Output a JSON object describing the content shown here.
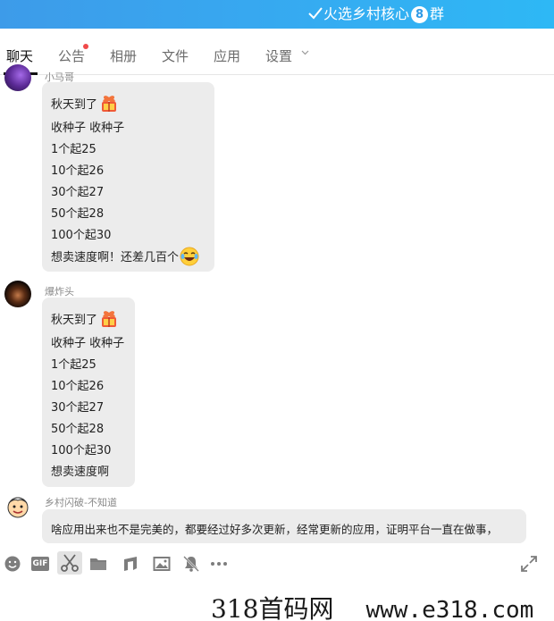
{
  "window": {
    "title_prefix": "火选乡村核心",
    "badge": "8",
    "title_suffix": "群"
  },
  "tabs": [
    {
      "label": "聊天",
      "active": true
    },
    {
      "label": "公告",
      "has_dot": true
    },
    {
      "label": "相册"
    },
    {
      "label": "文件"
    },
    {
      "label": "应用"
    },
    {
      "label": "设置"
    }
  ],
  "messages": [
    {
      "sender": "小马哥",
      "lines": [
        "秋天到了",
        "收种子 收种子",
        "1个起25",
        "10个起26",
        "30个起27",
        "50个起28",
        "100个起30",
        "想卖速度啊！还差几百个"
      ]
    },
    {
      "sender": "爆炸头",
      "lines": [
        "秋天到了",
        "收种子 收种子",
        "1个起25",
        "10个起26",
        "30个起27",
        "50个起28",
        "100个起30",
        "想卖速度啊"
      ]
    },
    {
      "sender": "乡村闪破-不知道",
      "lines": [
        "啥应用出来也不是完美的，都要经过好多次更新，经常更新的应用，证明平台一直在做事，"
      ]
    }
  ],
  "toolbar": {
    "gif_label": "GIF"
  },
  "watermark": {
    "site": "318首码网",
    "url": "www.e318.com"
  },
  "colors": {
    "titlebar": "#37a8f0",
    "bubble": "#ececec",
    "unread_dot": "#f04a4a"
  }
}
